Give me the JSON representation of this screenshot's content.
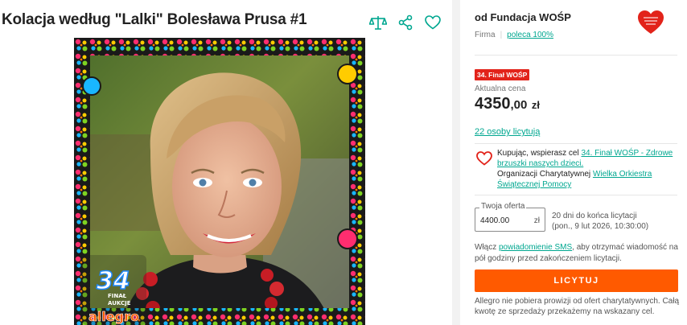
{
  "listing": {
    "title": "Kolacja według \"Lalki\" Bolesława Prusa #1",
    "actions": [
      {
        "name": "compare-icon",
        "color": "#00a790"
      },
      {
        "name": "share-icon",
        "color": "#00a790"
      },
      {
        "name": "heart-outline-icon",
        "color": "#00a790"
      }
    ],
    "photo": {
      "badge_number": "34",
      "badge_lines": [
        "FINAŁ",
        "AUKCJE"
      ],
      "badge_brand": "allegro"
    }
  },
  "seller": {
    "name": "od Fundacja WOŚP",
    "type": "Firma",
    "recommend": "poleca 100%",
    "logo_icon": "wosp-heart-logo-icon",
    "logo_color": "#e2231a"
  },
  "offer": {
    "badge": "34. Finał WOŚP",
    "price_label": "Aktualna cena",
    "price_int": "4350",
    "price_dec": ",00",
    "currency": "zł",
    "bidders": "22 osoby licytują"
  },
  "charity": {
    "prefix": "Kupując, wspierasz cel ",
    "cause_link": "34. Finał WOŚP - Zdrowe brzuszki naszych dzieci.",
    "org_prefix": "Organizacji Charytatywnej ",
    "org_link": "Wielka Orkiestra Świątecznej Pomocy"
  },
  "bid": {
    "field_label": "Twoja oferta",
    "field_value": "4400.00",
    "unit": "zł",
    "time_left": "20 dni do końca licytacji",
    "end_date": "(pon., 9 lut 2026, 10:30:00)",
    "notify_prefix": "Włącz ",
    "notify_link": "powiadomienie SMS",
    "notify_suffix": ", aby otrzymać wiadomość na pół godziny przed zakończeniem licytacji.",
    "button_label": "LICYTUJ",
    "button_color": "#ff5a00",
    "footnote": "Allegro nie pobiera prowizji od ofert charytatywnych. Całą kwotę ze sprzedaży przekażemy na wskazany cel."
  }
}
